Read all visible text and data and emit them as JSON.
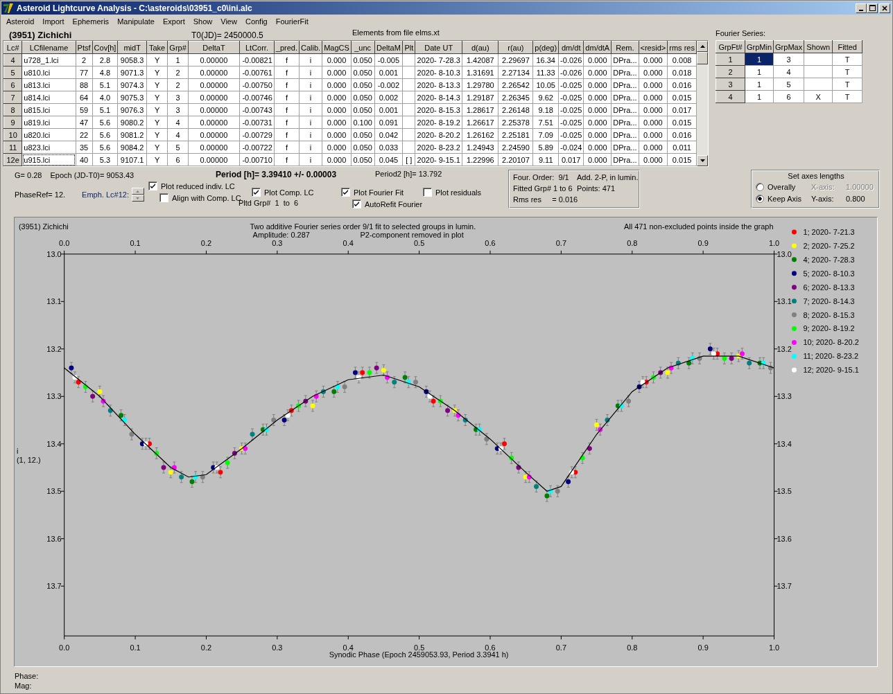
{
  "window": {
    "title": "Asteroid Lightcurve Analysis - C:\\asteroids\\03951_c0\\ini.alc"
  },
  "menu": [
    "Asteroid",
    "Import",
    "Ephemeris",
    "Manipulate",
    "Export",
    "Show",
    "View",
    "Config",
    "FourierFit"
  ],
  "header": {
    "asteroid": "(3951) Zichichi",
    "t0": "T0(JD)= 2450000.5",
    "elements": "Elements from file elms.xt"
  },
  "lc_table": {
    "columns": [
      "Lc#",
      "LCfilename",
      "Ptsf",
      "Cov[h]",
      "midT",
      "Take",
      "Grp#",
      "DeltaT",
      "LtCorr.",
      "_pred.",
      "Calib.",
      "MagCS",
      "_unc",
      "DeltaM",
      "Plt",
      "Date UT",
      "d(au)",
      "r(au)",
      "p(deg)",
      "dm/dt",
      "dm/dtA",
      "Rem.",
      "<resid>",
      "rms res"
    ],
    "rows": [
      {
        "focused": false,
        "cells": [
          "4",
          "u728_1.lci",
          "2",
          "2.8",
          "9058.3",
          "Y",
          "1",
          "0.00000",
          "-0.00821",
          "f",
          "i",
          "0.000",
          "0.050",
          "-0.005",
          null,
          "2020- 7-28.3",
          "1.42087",
          "2.29697",
          "16.34",
          "-0.026",
          "0.000",
          "DPra...",
          "0.000",
          "0.008"
        ]
      },
      {
        "focused": false,
        "cells": [
          "5",
          "u810.lci",
          "77",
          "4.8",
          "9071.3",
          "Y",
          "2",
          "0.00000",
          "-0.00761",
          "f",
          "i",
          "0.000",
          "0.050",
          "0.001",
          null,
          "2020- 8-10.3",
          "1.31691",
          "2.27134",
          "11.33",
          "-0.026",
          "0.000",
          "DPra...",
          "0.000",
          "0.018"
        ]
      },
      {
        "focused": false,
        "cells": [
          "6",
          "u813.lci",
          "88",
          "5.1",
          "9074.3",
          "Y",
          "2",
          "0.00000",
          "-0.00750",
          "f",
          "i",
          "0.000",
          "0.050",
          "-0.002",
          null,
          "2020- 8-13.3",
          "1.29780",
          "2.26542",
          "10.05",
          "-0.025",
          "0.000",
          "DPra...",
          "0.000",
          "0.016"
        ]
      },
      {
        "focused": false,
        "cells": [
          "7",
          "u814.lci",
          "64",
          "4.0",
          "9075.3",
          "Y",
          "3",
          "0.00000",
          "-0.00746",
          "f",
          "i",
          "0.000",
          "0.050",
          "0.002",
          null,
          "2020- 8-14.3",
          "1.29187",
          "2.26345",
          "9.62",
          "-0.025",
          "0.000",
          "DPra...",
          "0.000",
          "0.015"
        ]
      },
      {
        "focused": false,
        "cells": [
          "8",
          "u815.lci",
          "59",
          "5.1",
          "9076.3",
          "Y",
          "3",
          "0.00000",
          "-0.00743",
          "f",
          "i",
          "0.000",
          "0.050",
          "0.001",
          null,
          "2020- 8-15.3",
          "1.28617",
          "2.26148",
          "9.18",
          "-0.025",
          "0.000",
          "DPra...",
          "0.000",
          "0.017"
        ]
      },
      {
        "focused": false,
        "cells": [
          "9",
          "u819.lci",
          "47",
          "5.6",
          "9080.2",
          "Y",
          "4",
          "0.00000",
          "-0.00731",
          "f",
          "i",
          "0.000",
          "0.100",
          "0.091",
          null,
          "2020- 8-19.2",
          "1.26617",
          "2.25378",
          "7.51",
          "-0.025",
          "0.000",
          "DPra...",
          "0.000",
          "0.015"
        ]
      },
      {
        "focused": false,
        "cells": [
          "10",
          "u820.lci",
          "22",
          "5.6",
          "9081.2",
          "Y",
          "4",
          "0.00000",
          "-0.00729",
          "f",
          "i",
          "0.000",
          "0.050",
          "0.042",
          null,
          "2020- 8-20.2",
          "1.26162",
          "2.25181",
          "7.09",
          "-0.025",
          "0.000",
          "DPra...",
          "0.000",
          "0.016"
        ]
      },
      {
        "focused": false,
        "cells": [
          "11",
          "u823.lci",
          "35",
          "5.6",
          "9084.2",
          "Y",
          "5",
          "0.00000",
          "-0.00722",
          "f",
          "i",
          "0.000",
          "0.050",
          "0.033",
          null,
          "2020- 8-23.2",
          "1.24943",
          "2.24590",
          "5.89",
          "-0.024",
          "0.000",
          "DPra...",
          "0.000",
          "0.011"
        ]
      },
      {
        "focused": true,
        "cells": [
          "12e",
          "u915.lci",
          "40",
          "5.3",
          "9107.1",
          "Y",
          "6",
          "0.00000",
          "-0.00710",
          "f",
          "i",
          "0.000",
          "0.050",
          "0.045",
          "[ ]",
          "2020- 9-15.1",
          "1.22996",
          "2.20107",
          "9.11",
          "0.017",
          "0.000",
          "DPra...",
          "0.000",
          "0.015"
        ]
      }
    ]
  },
  "fourier": {
    "label": "Fourier Series:",
    "columns": [
      "GrpFt#",
      "GrpMin",
      "GrpMax",
      "Shown",
      "Fitted"
    ],
    "rows": [
      {
        "selected": true,
        "grp": "1",
        "min": "1",
        "max": "3",
        "fitted": "T"
      },
      {
        "selected": false,
        "grp": "2",
        "min": "1",
        "max": "4",
        "fitted": "T"
      },
      {
        "selected": false,
        "grp": "3",
        "min": "1",
        "max": "5",
        "fitted": "T"
      },
      {
        "selected": false,
        "grp": "4",
        "min": "1",
        "max": "6",
        "shown": "X",
        "fitted": "T"
      }
    ]
  },
  "info": {
    "g": "G= 0.28",
    "epoch": "Epoch (JD-T0)= 9053.43",
    "period": "Period [h]= 3.39410 +/- 0.00003",
    "period2": "Period2 [h]= 13.792",
    "phase_ref": "PhaseRef= 12.",
    "emph": "Emph. Lc#12:",
    "pltd_grp": "Pltd Grp#  1  to  6"
  },
  "checkboxes": [
    {
      "label": "Plot reduced indiv. LC",
      "checked": true
    },
    {
      "label": "Align with Comp. LC",
      "checked": false
    },
    {
      "label": "Plot Comp. LC",
      "checked": true
    },
    {
      "label": "Plot Fourier Fit",
      "checked": true
    },
    {
      "label": "AutoRefit Fourier",
      "checked": true
    },
    {
      "label": "Plot residuals",
      "checked": false
    }
  ],
  "fit_info": [
    "Four. Order:  9/1",
    "Add. 2-P, in lumin.",
    "Fitted Grp# 1 to 6",
    "Points: 471",
    "Rms res     = 0.016"
  ],
  "axes": {
    "title": "Set axes lengths",
    "options": [
      {
        "label": "Overally",
        "selected": false
      },
      {
        "label": "Keep Axis",
        "selected": true
      }
    ],
    "fields": [
      {
        "label": "X-axis:",
        "value": "1.00000",
        "disabled": true
      },
      {
        "label": "Y-axis:",
        "value": "0.800",
        "disabled": false
      }
    ]
  },
  "plot": {
    "name": "(3951) Zichichi",
    "amplitude": "Amplitude: 0.287",
    "note": "P2-component removed in plot",
    "points_note": "All 471 non-excluded points inside the graph",
    "y_note": "(1, 12.)",
    "top_axis_labels": [
      "0.0",
      "0.1",
      "0.2",
      "0.3",
      "0.4",
      "0.5",
      "0.6",
      "0.7",
      "0.8",
      "0.9",
      "1.0"
    ],
    "right_axis_labels": [
      "13.0",
      "13.1",
      "13.2",
      "13.3",
      "13.4",
      "13.5",
      "13.6",
      "13.7"
    ],
    "chart_data": {
      "type": "scatter",
      "title": "Two additive Fourier series order 9/1 fit to selected groups in lumin.",
      "legend": "right",
      "xlabel": "Synodic Phase (Epoch 2459053.93, Period 3.3941 h)",
      "ylabel": "i",
      "xlim": [
        0,
        1
      ],
      "ylim": [
        13.805,
        13.0
      ],
      "xticks": [
        {
          "value": 0,
          "label": "0.0"
        },
        {
          "value": 0.1,
          "label": "0.1"
        },
        {
          "value": 0.2,
          "label": "0.2"
        },
        {
          "value": 0.3,
          "label": "0.3"
        },
        {
          "value": 0.4,
          "label": "0.4"
        },
        {
          "value": 0.5,
          "label": "0.5"
        },
        {
          "value": 0.6,
          "label": "0.6"
        },
        {
          "value": 0.7,
          "label": "0.7"
        },
        {
          "value": 0.8,
          "label": "0.8"
        },
        {
          "value": 0.9,
          "label": "0.9"
        },
        {
          "value": 1,
          "label": "1.0"
        }
      ],
      "yticks": [
        {
          "value": 13.0,
          "label": "13.0"
        },
        {
          "value": 13.1,
          "label": "13.1"
        },
        {
          "value": 13.2,
          "label": "13.2"
        },
        {
          "value": 13.3,
          "label": "13.3"
        },
        {
          "value": 13.4,
          "label": "13.4"
        },
        {
          "value": 13.5,
          "label": "13.5"
        },
        {
          "value": 13.6,
          "label": "13.6"
        },
        {
          "value": 13.7,
          "label": "13.7"
        }
      ],
      "series": [
        {
          "type": "scatter",
          "name": "1; 2020- 7-21.3",
          "color": "#ff0000",
          "x": [
            0.02,
            0.12,
            0.22,
            0.32,
            0.42,
            0.52,
            0.62,
            0.72,
            0.82,
            0.92
          ],
          "values": [
            13.27,
            13.4,
            13.46,
            13.33,
            13.25,
            13.31,
            13.4,
            13.46,
            13.27,
            13.21
          ]
        },
        {
          "type": "scatter",
          "name": "2; 2020- 7-25.2",
          "color": "#ffff00",
          "x": [
            0.05,
            0.15,
            0.25,
            0.35,
            0.45,
            0.55,
            0.65,
            0.75,
            0.85,
            0.95
          ],
          "values": [
            13.29,
            13.46,
            13.41,
            13.32,
            13.245,
            13.33,
            13.47,
            13.36,
            13.25,
            13.215
          ]
        },
        {
          "type": "scatter",
          "name": "4; 2020- 7-28.3",
          "color": "#008000",
          "x": [
            0.08,
            0.18,
            0.28,
            0.38,
            0.48,
            0.58,
            0.68,
            0.78,
            0.88,
            0.98
          ],
          "values": [
            13.34,
            13.48,
            13.37,
            13.29,
            13.26,
            13.37,
            13.51,
            13.32,
            13.23,
            13.23
          ]
        },
        {
          "type": "scatter",
          "name": "5; 2020- 8-10.3",
          "color": "#000080",
          "x": [
            0.01,
            0.11,
            0.21,
            0.31,
            0.41,
            0.51,
            0.61,
            0.71,
            0.81,
            0.91
          ],
          "values": [
            13.24,
            13.4,
            13.45,
            13.35,
            13.25,
            13.29,
            13.41,
            13.48,
            13.28,
            13.2
          ]
        },
        {
          "type": "scatter",
          "name": "6; 2020- 8-13.3",
          "color": "#800080",
          "x": [
            0.04,
            0.14,
            0.24,
            0.34,
            0.44,
            0.54,
            0.64,
            0.74,
            0.84,
            0.94
          ],
          "values": [
            13.3,
            13.45,
            13.42,
            13.31,
            13.24,
            13.33,
            13.45,
            13.41,
            13.25,
            13.22
          ]
        },
        {
          "type": "scatter",
          "name": "7; 2020- 8-14.3",
          "color": "#008080",
          "x": [
            0.065,
            0.165,
            0.265,
            0.365,
            0.465,
            0.565,
            0.665,
            0.765,
            0.865,
            0.965
          ],
          "values": [
            13.33,
            13.47,
            13.38,
            13.29,
            13.27,
            13.35,
            13.49,
            13.35,
            13.23,
            13.23
          ]
        },
        {
          "type": "scatter",
          "name": "8; 2020- 8-15.3",
          "color": "#808080",
          "x": [
            0.095,
            0.195,
            0.295,
            0.395,
            0.495,
            0.595,
            0.695,
            0.795,
            0.895,
            0.995
          ],
          "values": [
            13.38,
            13.47,
            13.35,
            13.28,
            13.27,
            13.39,
            13.5,
            13.31,
            13.22,
            13.24
          ]
        },
        {
          "type": "scatter",
          "name": "9; 2020- 8-19.2",
          "color": "#00ff00",
          "x": [
            0.03,
            0.13,
            0.23,
            0.33,
            0.43,
            0.53,
            0.63,
            0.73,
            0.83,
            0.93
          ],
          "values": [
            13.28,
            13.42,
            13.44,
            13.32,
            13.25,
            13.31,
            13.43,
            13.43,
            13.26,
            13.22
          ]
        },
        {
          "type": "scatter",
          "name": "10; 2020- 8-20.2",
          "color": "#ff00ff",
          "x": [
            0.055,
            0.155,
            0.255,
            0.355,
            0.455,
            0.555,
            0.655,
            0.755,
            0.855,
            0.955
          ],
          "values": [
            13.31,
            13.45,
            13.41,
            13.3,
            13.26,
            13.34,
            13.47,
            13.37,
            13.24,
            13.21
          ]
        },
        {
          "type": "scatter",
          "name": "11; 2020- 8-23.2",
          "color": "#00ffff",
          "x": [
            0.085,
            0.185,
            0.285,
            0.385,
            0.485,
            0.585,
            0.685,
            0.785,
            0.885,
            0.985
          ],
          "values": [
            13.35,
            13.47,
            13.37,
            13.28,
            13.27,
            13.37,
            13.5,
            13.32,
            13.22,
            13.23
          ]
        },
        {
          "type": "scatter",
          "name": "12; 2020- 9-15.1",
          "color": "#ffffff",
          "x": [
            0.015,
            0.115,
            0.215,
            0.315,
            0.415,
            0.515,
            0.615,
            0.715,
            0.815,
            0.915
          ],
          "values": [
            13.26,
            13.4,
            13.45,
            13.34,
            13.26,
            13.3,
            13.41,
            13.46,
            13.27,
            13.21
          ]
        },
        {
          "type": "line",
          "color": "#000000",
          "x": [
            0,
            0.05,
            0.1,
            0.15,
            0.175,
            0.2,
            0.25,
            0.3,
            0.35,
            0.4,
            0.45,
            0.5,
            0.55,
            0.6,
            0.65,
            0.68,
            0.7,
            0.75,
            0.8,
            0.85,
            0.9,
            0.95,
            1
          ],
          "values": [
            13.24,
            13.3,
            13.38,
            13.45,
            13.47,
            13.465,
            13.41,
            13.35,
            13.3,
            13.265,
            13.255,
            13.28,
            13.33,
            13.39,
            13.46,
            13.5,
            13.49,
            13.38,
            13.29,
            13.24,
            13.215,
            13.215,
            13.24
          ]
        }
      ]
    }
  },
  "status": [
    "Phase:",
    "Mag:"
  ]
}
